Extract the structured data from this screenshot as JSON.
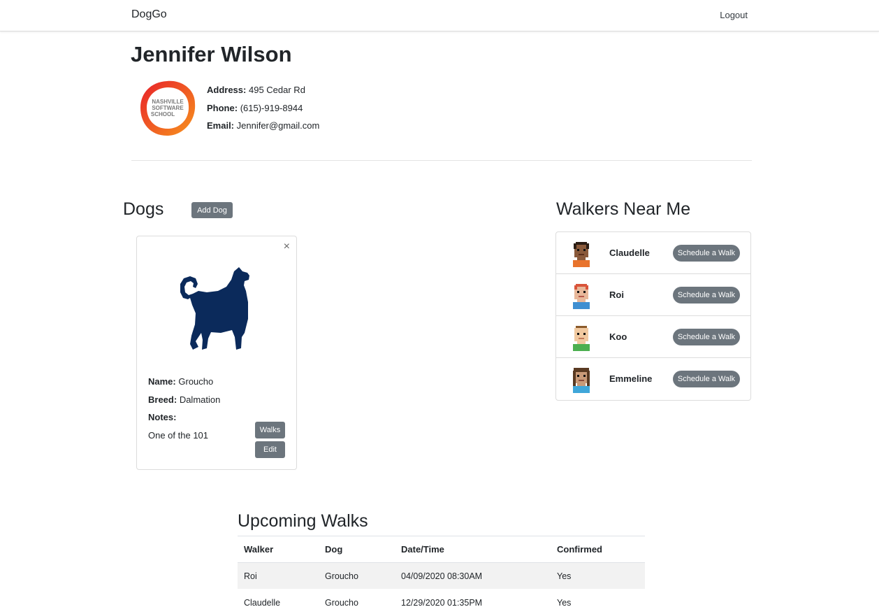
{
  "nav": {
    "brand": "DogGo",
    "logout": "Logout"
  },
  "owner": {
    "name": "Jennifer Wilson",
    "address_label": "Address:",
    "address": "495 Cedar Rd",
    "phone_label": "Phone:",
    "phone": "(615)-919-8944",
    "email_label": "Email:",
    "email": "Jennifer@gmail.com",
    "logo_text": [
      "NASHVILLE",
      "SOFTWARE",
      "SCHOOL"
    ]
  },
  "dogs": {
    "title": "Dogs",
    "add_button": "Add Dog",
    "items": [
      {
        "name_label": "Name:",
        "name": "Groucho",
        "breed_label": "Breed:",
        "breed": "Dalmation",
        "notes_label": "Notes:",
        "notes": "One of the 101",
        "walks_button": "Walks",
        "edit_button": "Edit",
        "close_icon": "×"
      }
    ]
  },
  "walkers": {
    "title": "Walkers Near Me",
    "items": [
      {
        "name": "Claudelle",
        "button": "Schedule a Walk",
        "skin": "#8a5a3b",
        "hair": "#2b1d14",
        "shirt": "#e8732c"
      },
      {
        "name": "Roi",
        "button": "Schedule a Walk",
        "skin": "#e8b89a",
        "hair": "#d9543a",
        "shirt": "#3f8fd1"
      },
      {
        "name": "Koo",
        "button": "Schedule a Walk",
        "skin": "#f1c9a0",
        "hair": "#8a5a2b",
        "shirt": "#4caf50"
      },
      {
        "name": "Emmeline",
        "button": "Schedule a Walk",
        "skin": "#c99a78",
        "hair": "#5a3a22",
        "shirt": "#3fa6d9"
      }
    ]
  },
  "walks": {
    "title": "Upcoming Walks",
    "headers": {
      "walker": "Walker",
      "dog": "Dog",
      "datetime": "Date/Time",
      "confirmed": "Confirmed"
    },
    "rows": [
      {
        "walker": "Roi",
        "dog": "Groucho",
        "datetime": "04/09/2020 08:30AM",
        "confirmed": "Yes"
      },
      {
        "walker": "Claudelle",
        "dog": "Groucho",
        "datetime": "12/29/2020 01:35PM",
        "confirmed": "Yes"
      }
    ]
  },
  "colors": {
    "button_grey": "#6c757d",
    "dog_silhouette": "#0b2a5b",
    "logo_orange": "#f15a24",
    "logo_red": "#e8202a"
  }
}
